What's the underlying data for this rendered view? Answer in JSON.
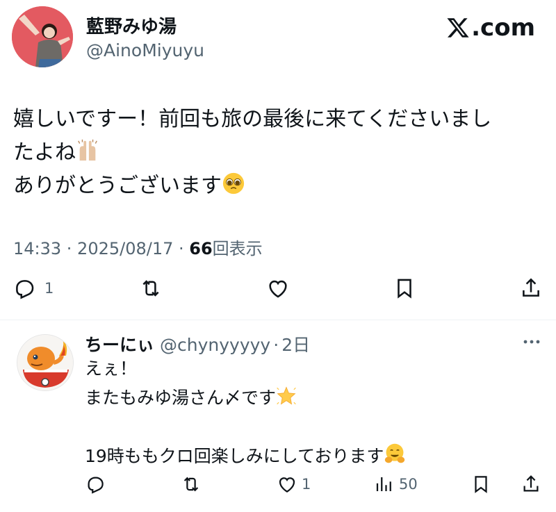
{
  "brand": {
    "label": ".com",
    "icon": "x-logo-icon"
  },
  "tweet": {
    "author_name": "藍野みゆ湯",
    "author_handle": "@AinoMiyuyu",
    "text_line1": "嬉しいですー！前回も旅の最後に来てくださいまし",
    "text_line2": "たよね",
    "text_line3": "ありがとうございます",
    "emoji1": "raising-hands-icon",
    "emoji2": "pleading-face-icon",
    "time": "14:33 · 2025/08/17 · ",
    "views_count": "66",
    "views_label": "回表示",
    "reply_count": "1"
  },
  "reply": {
    "author_name": "ちーにぃ",
    "author_handle": "@chynyyyyy",
    "separator": "·",
    "time": "2日",
    "text_line1": "えぇ！",
    "text_line2": "またもみゆ湯さん〆です",
    "text_line3": "19時ももクロ回楽しみにしております",
    "emoji1": "glowing-star-icon",
    "emoji2": "hugging-face-icon",
    "like_count": "1",
    "views_count": "50"
  },
  "colors": {
    "text": "#0f1419",
    "secondary": "#536471",
    "divider": "#eff3f4"
  }
}
